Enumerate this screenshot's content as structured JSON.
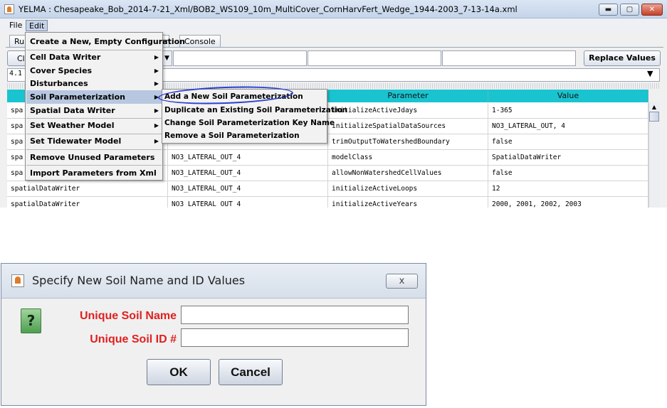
{
  "window": {
    "title": "YELMA : Chesapeake_Bob_2014-7-21_Xml/BOB2_WS109_10m_MultiCover_CornHarvFert_Wedge_1944-2003_7-13-14a.xml",
    "controls": {
      "minimize": "▬",
      "maximize": "▢",
      "close": "✕"
    }
  },
  "menubar": {
    "file": "File",
    "edit": "Edit"
  },
  "tabs": {
    "run": "Ru",
    "chart": "art",
    "console": "Console"
  },
  "toolbar": {
    "cl_button": "Cl",
    "replace_values": "Replace Values"
  },
  "second_row": {
    "value": "4.1"
  },
  "table": {
    "columns": [
      "",
      "",
      "Parameter",
      "Value"
    ],
    "rows": [
      [
        "spa",
        "",
        "initializeActiveJdays",
        "1-365"
      ],
      [
        "spa",
        "",
        "initializeSpatialDataSources",
        "NO3_LATERAL_OUT, 4"
      ],
      [
        "spa",
        "",
        "trimOutputToWatershedBoundary",
        "false"
      ],
      [
        "spa",
        "NO3_LATERAL_OUT_4",
        "modelClass",
        "SpatialDataWriter"
      ],
      [
        "spa",
        "NO3_LATERAL_OUT_4",
        "allowNonWatershedCellValues",
        "false"
      ],
      [
        "spatialDataWriter",
        "NO3_LATERAL_OUT_4",
        "initializeActiveLoops",
        "12"
      ],
      [
        "spatialDataWriter",
        "NO3_LATERAL_OUT_4",
        "initializeActiveYears",
        "2000, 2001, 2002, 2003"
      ]
    ]
  },
  "edit_menu": {
    "items": [
      "Create a New, Empty Configuration",
      "Cell Data Writer",
      "Cover Species",
      "Disturbances",
      "Soil Parameterization",
      "Spatial Data Writer",
      "Set Weather Model",
      "Set Tidewater Model",
      "Remove Unused Parameters",
      "Import Parameters from Xml"
    ]
  },
  "soil_submenu": {
    "items": [
      "Add a New Soil Parameterization",
      "Duplicate an Existing Soil Parameterization",
      "Change Soil Parameterization Key Name",
      "Remove a Soil Parameterization"
    ]
  },
  "dialog": {
    "title": "Specify New Soil Name and ID Values",
    "close_glyph": "x",
    "question_glyph": "?",
    "name_label": "Unique Soil Name",
    "name_value": "",
    "id_label": "Unique Soil ID #",
    "id_value": "",
    "ok": "OK",
    "cancel": "Cancel"
  }
}
